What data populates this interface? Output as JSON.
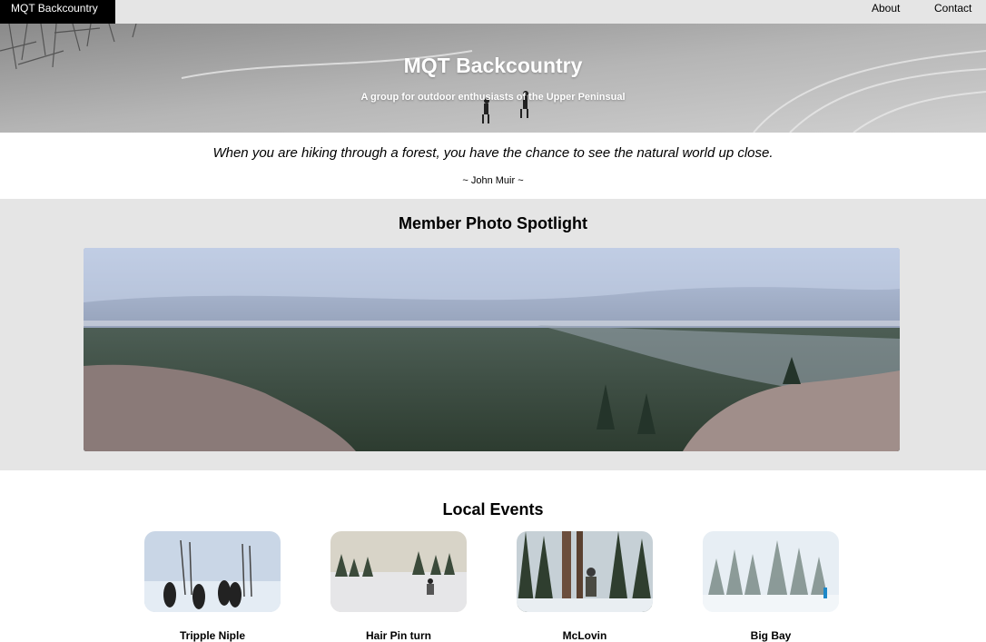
{
  "nav": {
    "brand": "MQT Backcountry",
    "links": [
      "About",
      "Contact"
    ]
  },
  "hero": {
    "title": "MQT Backcountry",
    "subtitle": "A group for outdoor enthusiasts of the Upper Peninsual"
  },
  "quote": {
    "text": "When you are hiking through a forest, you have the chance to see the natural world up close.",
    "author": "~ John Muir ~"
  },
  "spotlight": {
    "title": "Member Photo Spotlight"
  },
  "events": {
    "title": "Local Events",
    "items": [
      {
        "label": "Tripple Niple"
      },
      {
        "label": "Hair Pin turn"
      },
      {
        "label": "McLovin"
      },
      {
        "label": "Big Bay"
      }
    ]
  },
  "colors": {
    "nav_bg": "#e5e5e5",
    "brand_bg": "#000000",
    "section_bg": "#e5e5e5"
  }
}
